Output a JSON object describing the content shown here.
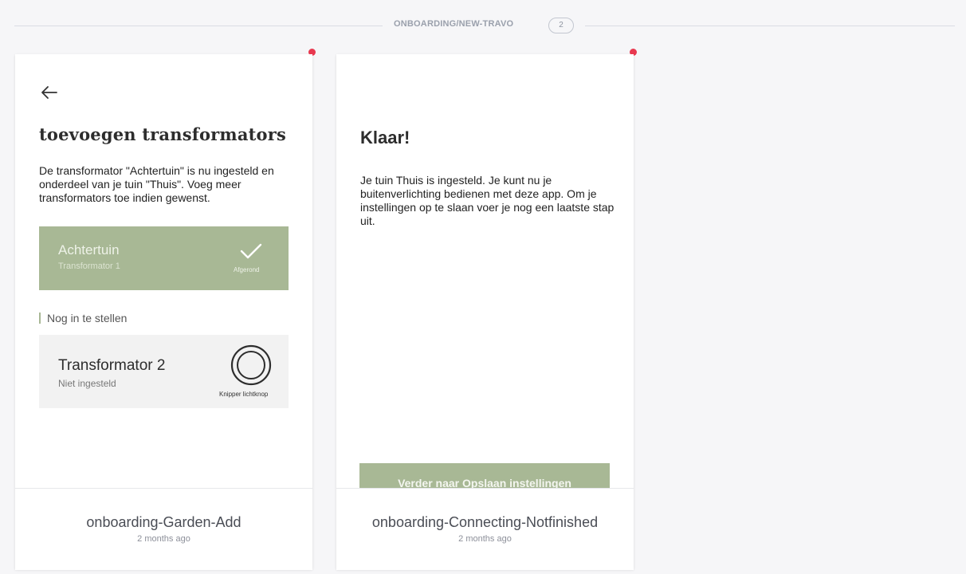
{
  "section": {
    "title": "ONBOARDING/NEW-TRAVO",
    "count": "2"
  },
  "cards": [
    {
      "screen": {
        "title": "toevoegen transformators",
        "description": "De transformator \"Achtertuin\" is nu ingesteld en onderdeel van je tuin \"Thuis\". Voeg meer transformators toe indien gewenst.",
        "done_item": {
          "name": "Achtertuin",
          "subtitle": "Transformator 1",
          "status": "Afgerond"
        },
        "todo_label": "Nog in te stellen",
        "todo_item": {
          "name": "Transformator 2",
          "subtitle": "Niet ingesteld",
          "action_label": "Knipper lichtknop"
        }
      },
      "name": "onboarding-Garden-Add",
      "time": "2 months ago"
    },
    {
      "screen": {
        "title": "Klaar!",
        "description": "Je tuin Thuis is ingesteld. Je kunt nu je buitenverlichting bedienen met deze app. Om je instellingen op te slaan voer je nog een laatste stap uit.",
        "button_label": "Verder naar Opslaan instellingen"
      },
      "name": "onboarding-Connecting-Notfinished",
      "time": "2 months ago"
    }
  ],
  "colors": {
    "accent_green": "#a8b895",
    "pin_red": "#e8384f",
    "background": "#f6f6f8"
  },
  "icons": [
    "back-arrow-icon",
    "checkmark-icon",
    "blink-ring-icon"
  ]
}
